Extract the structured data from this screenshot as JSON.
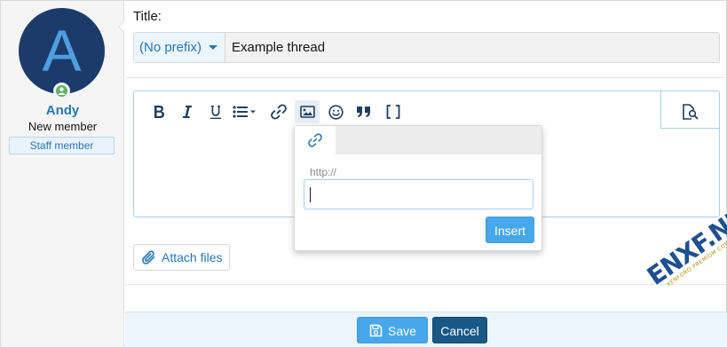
{
  "user": {
    "avatar_letter": "A",
    "name": "Andy",
    "title": "New member",
    "banner": "Staff member"
  },
  "form": {
    "title_label": "Title:",
    "prefix_value": "(No prefix)",
    "title_value": "Example thread"
  },
  "toolbar": {
    "items": [
      "bold-icon",
      "italic-icon",
      "underline-icon",
      "list-icon",
      "link-icon",
      "image-icon",
      "smilie-icon",
      "quote-icon",
      "code-icon",
      "preview-icon"
    ]
  },
  "link_popup": {
    "tab_icon": "link-icon",
    "label": "http://",
    "url_value": "",
    "insert_label": "Insert"
  },
  "attach": {
    "label": "Attach files"
  },
  "actions": {
    "save_label": "Save",
    "cancel_label": "Cancel"
  },
  "watermark": {
    "main": "ENXF.NET",
    "sub": "XENFORO PREMIUM COMMUNITY"
  },
  "colors": {
    "accent": "#2577b1",
    "primary_button": "#47a7eb",
    "cancel_button": "#185886",
    "avatar_bg": "#1b3c6b",
    "online": "#63b265"
  }
}
